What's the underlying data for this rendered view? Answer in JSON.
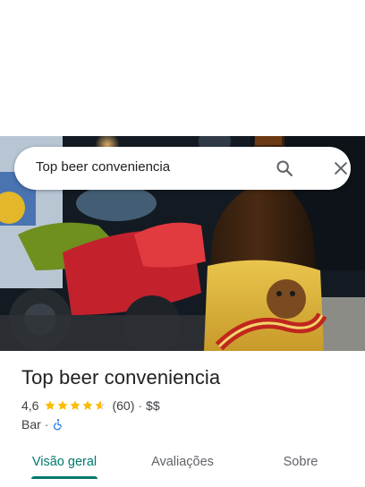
{
  "search": {
    "query": "Top beer conveniencia",
    "search_icon": "search-icon",
    "close_icon": "close-icon"
  },
  "hero": {
    "image": "photo-beer-bottle-and-motorcycles"
  },
  "place": {
    "name": "Top beer conveniencia",
    "rating": "4,6",
    "rating_value": 4.6,
    "review_count": "(60)",
    "separator": "·",
    "price_level": "$$",
    "category": "Bar",
    "accessibility_icon": "wheelchair-icon"
  },
  "tabs": [
    {
      "label": "Visão geral",
      "active": true
    },
    {
      "label": "Avaliações",
      "active": false
    },
    {
      "label": "Sobre",
      "active": false
    }
  ],
  "colors": {
    "accent": "#00796b",
    "star": "#fbbc04",
    "accessibility": "#1a73e8"
  }
}
